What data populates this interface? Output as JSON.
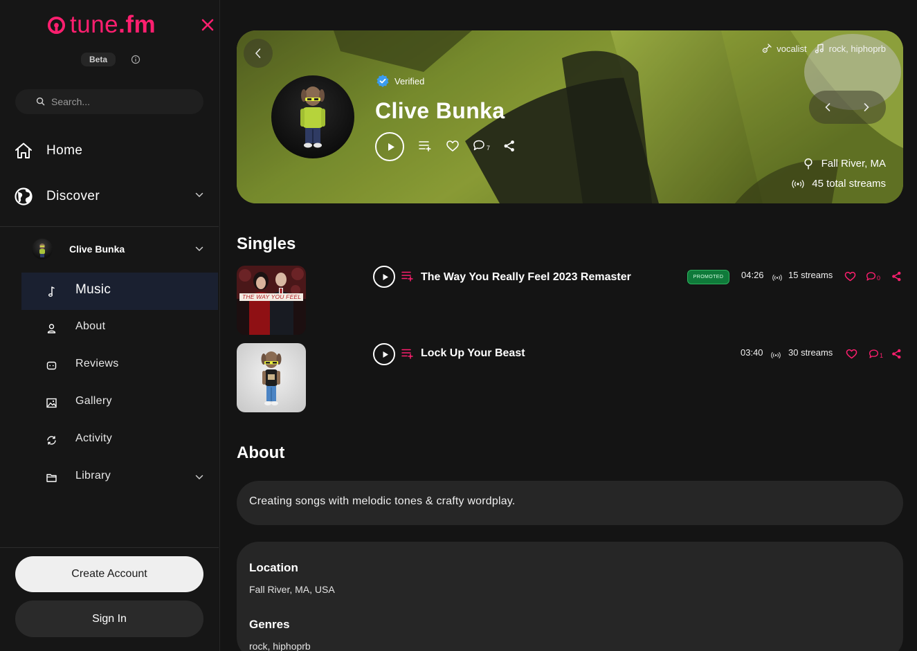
{
  "app": {
    "logo_text_light": "tune",
    "logo_text_bold": ".fm",
    "beta_label": "Beta",
    "accent_color": "#ff1f6f"
  },
  "search": {
    "placeholder": "Search..."
  },
  "nav": {
    "home": "Home",
    "discover": "Discover",
    "profile_name": "Clive Bunka",
    "sub_items": [
      {
        "label": "Music",
        "icon": "music-note-icon",
        "active": true
      },
      {
        "label": "About",
        "icon": "user-icon"
      },
      {
        "label": "Reviews",
        "icon": "reviews-icon"
      },
      {
        "label": "Gallery",
        "icon": "image-icon"
      },
      {
        "label": "Activity",
        "icon": "refresh-icon"
      },
      {
        "label": "Library",
        "icon": "folder-icon"
      }
    ]
  },
  "account": {
    "create_label": "Create Account",
    "signin_label": "Sign In"
  },
  "hero": {
    "verified_label": "Verified",
    "artist_name": "Clive Bunka",
    "comment_count": "7",
    "tag_role": "vocalist",
    "tag_genres": "rock, hiphoprb",
    "location": "Fall River, MA",
    "total_streams": "45 total streams"
  },
  "singles": {
    "title": "Singles",
    "cover_text_1": "THE WAY YOU FEEL",
    "tracks": [
      {
        "title": "The Way You Really Feel 2023 Remaster",
        "promoted": "PROMOTED",
        "duration": "04:26",
        "streams": "15 streams",
        "comments": "0"
      },
      {
        "title": "Lock Up Your Beast",
        "duration": "03:40",
        "streams": "30 streams",
        "comments": "1"
      }
    ]
  },
  "about": {
    "title": "About",
    "bio": "Creating songs with melodic tones & crafty wordplay.",
    "location_label": "Location",
    "location_value": "Fall River, MA, USA",
    "genres_label": "Genres",
    "genres_value": "rock, hiphoprb"
  }
}
